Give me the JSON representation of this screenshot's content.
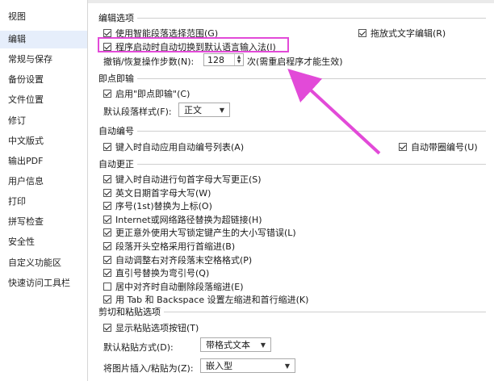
{
  "sidebar": {
    "items": [
      {
        "label": "视图",
        "active": false
      },
      {
        "label": "编辑",
        "active": true
      },
      {
        "label": "常规与保存",
        "active": false
      },
      {
        "label": "备份设置",
        "active": false
      },
      {
        "label": "文件位置",
        "active": false
      },
      {
        "label": "修订",
        "active": false
      },
      {
        "label": "中文版式",
        "active": false
      },
      {
        "label": "输出PDF",
        "active": false
      },
      {
        "label": "用户信息",
        "active": false
      },
      {
        "label": "打印",
        "active": false
      },
      {
        "label": "拼写检查",
        "active": false
      },
      {
        "label": "安全性",
        "active": false
      },
      {
        "label": "自定义功能区",
        "active": false
      },
      {
        "label": "快速访问工具栏",
        "active": false
      }
    ]
  },
  "sections": {
    "edit_options": "编辑选项",
    "click_input": "即点即输",
    "auto_number": "自动编号",
    "auto_correct": "自动更正",
    "cut_paste": "剪切和粘贴选项"
  },
  "edit": {
    "smart_para": "使用智能段落选择范围(G)",
    "drag_text": "拖放式文字编辑(R)",
    "auto_ime": "程序启动时自动切换到默认语言输入法(I)",
    "undo_label": "撤销/恢复操作步数(N):",
    "undo_value": "128",
    "undo_note": "次(需重启程序才能生效)"
  },
  "click_input": {
    "enable": "启用\"即点即输\"(C)",
    "default_style_label": "默认段落样式(F):",
    "default_style_value": "正文"
  },
  "auto_number": {
    "apply_list": "键入时自动应用自动编号列表(A)",
    "circle_number": "自动带圈编号(U)"
  },
  "auto_correct": {
    "items": [
      "键入时自动进行句首字母大写更正(S)",
      "英文日期首字母大写(W)",
      "序号(1st)替换为上标(O)",
      "Internet或网络路径替换为超链接(H)",
      "更正意外使用大写锁定键产生的大小写错误(L)",
      "段落开头空格采用行首缩进(B)",
      "自动调整右对齐段落末空格格式(P)",
      "直引号替换为弯引号(Q)",
      "居中对齐时自动删除段落缩进(E)",
      "用 Tab 和 Backspace 设置左缩进和首行缩进(K)"
    ],
    "checked": [
      true,
      true,
      true,
      true,
      true,
      true,
      true,
      true,
      false,
      true
    ]
  },
  "paste": {
    "show_button": "显示粘贴选项按钮(T)",
    "default_label": "默认粘贴方式(D):",
    "default_value": "带格式文本",
    "image_label": "将图片插入/粘贴为(Z):",
    "image_value": "嵌入型"
  },
  "colors": {
    "annotation": "#e24ad8",
    "sidebar_active": "#e6eefb"
  }
}
